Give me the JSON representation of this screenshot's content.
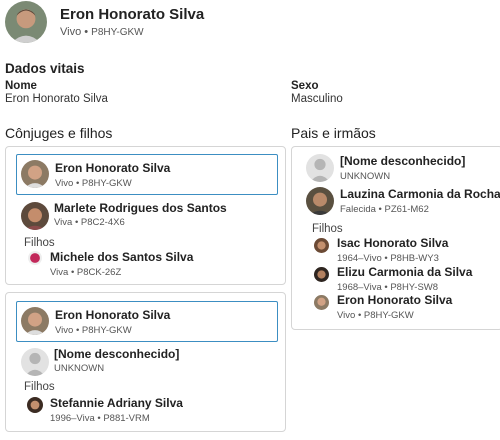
{
  "header": {
    "name": "Eron Honorato Silva",
    "status": "Vivo",
    "sep": " • ",
    "pid": "P8HY-GKW"
  },
  "vitals": {
    "title": "Dados vitais",
    "name_label": "Nome",
    "name_value": "Eron Honorato Silva",
    "sex_label": "Sexo",
    "sex_value": "Masculino"
  },
  "spouses_section": {
    "title": "Cônjuges e filhos",
    "families": [
      {
        "self": {
          "name": "Eron Honorato Silva",
          "meta": "Vivo • P8HY-GKW"
        },
        "spouse": {
          "name": "Marlete Rodrigues dos Santos",
          "meta": "Viva • P8C2-4X6"
        },
        "children_label": "Filhos",
        "children": [
          {
            "name": "Michele dos Santos Silva",
            "meta": "Viva • P8CK-26Z"
          }
        ]
      },
      {
        "self": {
          "name": "Eron Honorato Silva",
          "meta": "Vivo • P8HY-GKW"
        },
        "spouse": {
          "name": "[Nome desconhecido]",
          "meta": "UNKNOWN"
        },
        "children_label": "Filhos",
        "children": [
          {
            "name": "Stefannie Adriany Silva",
            "meta": "1996–Viva • P881-VRM"
          }
        ]
      }
    ]
  },
  "parents_section": {
    "title": "Pais e irmãos",
    "father": {
      "name": "[Nome desconhecido]",
      "meta": "UNKNOWN"
    },
    "mother": {
      "name": "Lauzina Carmonia da Rocha",
      "meta": "Falecida • PZ61-M62"
    },
    "children_label": "Filhos",
    "children": [
      {
        "name": "Isac Honorato Silva",
        "meta": "1964–Vivo • P8HB-WY3"
      },
      {
        "name": "Elizu Carmonia da Silva",
        "meta": "1968–Viva • P8HY-SW8"
      },
      {
        "name": "Eron Honorato Silva",
        "meta": "Vivo • P8HY-GKW"
      }
    ]
  },
  "colors": {
    "highlight_border": "#3c8ec2",
    "panel_border": "#d5d5d5",
    "unknown_avatar": "#c8c8c8"
  }
}
